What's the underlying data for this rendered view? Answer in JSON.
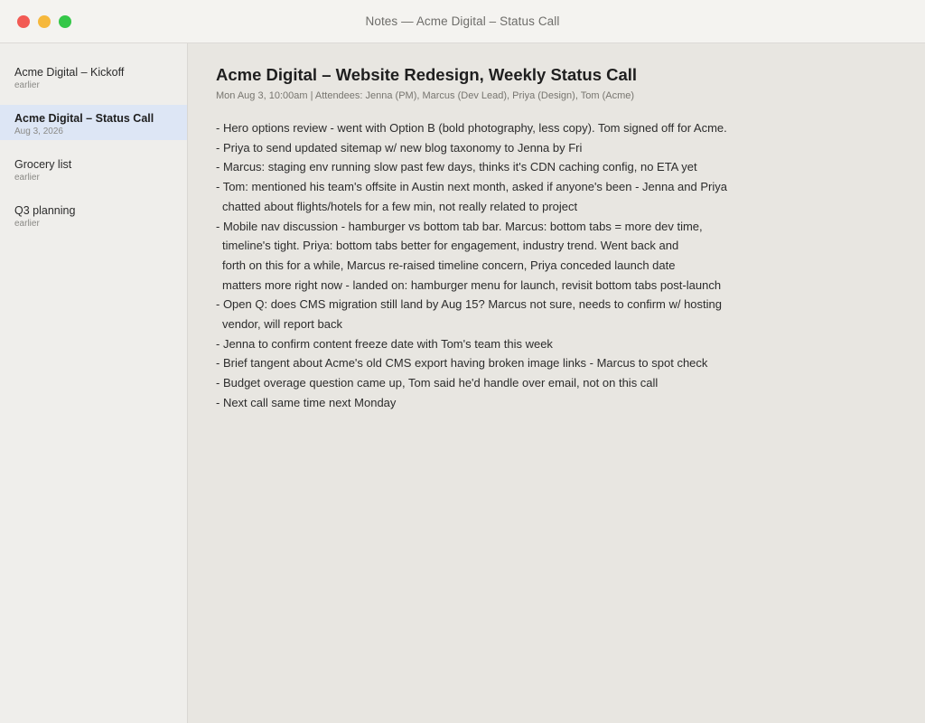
{
  "window": {
    "title": "Notes — Acme Digital – Status Call"
  },
  "sidebar": {
    "items": [
      {
        "title": "Acme Digital – Kickoff",
        "date": "earlier",
        "selected": false
      },
      {
        "title": "Acme Digital – Status Call",
        "date": "Aug 3, 2026",
        "selected": true
      },
      {
        "title": "Grocery list",
        "date": "earlier",
        "selected": false
      },
      {
        "title": "Q3 planning",
        "date": "earlier",
        "selected": false
      }
    ]
  },
  "note": {
    "title": "Acme Digital – Website Redesign, Weekly Status Call",
    "meta": "Mon Aug 3, 10:00am | Attendees: Jenna (PM), Marcus (Dev Lead), Priya (Design), Tom (Acme)",
    "lines": [
      "- Hero options review - went with Option B (bold photography, less copy). Tom signed off for Acme.",
      "- Priya to send updated sitemap w/ new blog taxonomy to Jenna by Fri",
      "- Marcus: staging env running slow past few days, thinks it's CDN caching config, no ETA yet",
      "- Tom: mentioned his team's offsite in Austin next month, asked if anyone's been - Jenna and Priya",
      "chatted about flights/hotels for a few min, not really related to project",
      "- Mobile nav discussion - hamburger vs bottom tab bar. Marcus: bottom tabs = more dev time,",
      "timeline's tight. Priya: bottom tabs better for engagement, industry trend. Went back and",
      "forth on this for a while, Marcus re-raised timeline concern, Priya conceded launch date",
      "matters more right now - landed on: hamburger menu for launch, revisit bottom tabs post-launch",
      "- Open Q: does CMS migration still land by Aug 15? Marcus not sure, needs to confirm w/ hosting",
      "vendor, will report back",
      "- Jenna to confirm content freeze date with Tom's team this week",
      "- Brief tangent about Acme's old CMS export having broken image links - Marcus to spot check",
      "- Budget overage question came up, Tom said he'd handle over email, not on this call",
      "- Next call same time next Monday"
    ]
  }
}
